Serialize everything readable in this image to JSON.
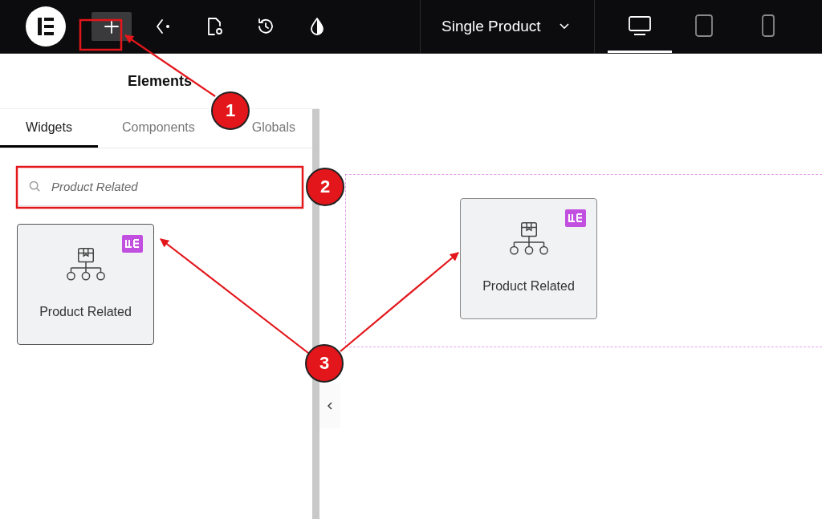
{
  "toolbar": {
    "tools": [
      {
        "kind": "logo",
        "selected": false
      },
      {
        "kind": "add",
        "selected": true
      },
      {
        "kind": "structure",
        "selected": false
      },
      {
        "kind": "page-settings",
        "selected": false
      },
      {
        "kind": "history",
        "selected": false
      },
      {
        "kind": "style",
        "selected": false
      }
    ],
    "document_title": "Single Product",
    "devices": [
      {
        "kind": "desktop",
        "selected": true
      },
      {
        "kind": "tablet",
        "selected": false
      },
      {
        "kind": "mobile",
        "selected": false
      }
    ]
  },
  "panel": {
    "title": "Elements",
    "tabs": [
      {
        "label": "Widgets",
        "selected": true
      },
      {
        "label": "Components",
        "selected": false
      },
      {
        "label": "Globals",
        "selected": false
      }
    ],
    "search": {
      "value": "Product Related"
    },
    "widgets": [
      {
        "label": "Product Related",
        "pro": true
      }
    ]
  },
  "canvas": {
    "widget": {
      "label": "Product Related",
      "pro": true
    }
  },
  "annotations": [
    {
      "label": "1"
    },
    {
      "label": "2"
    },
    {
      "label": "3"
    }
  ]
}
